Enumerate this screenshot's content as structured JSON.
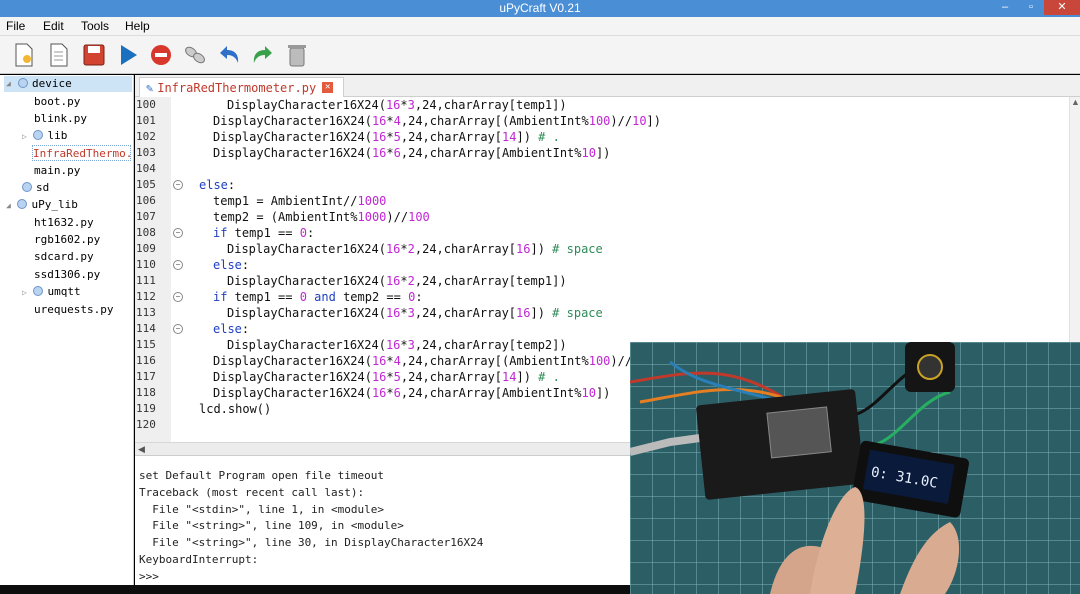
{
  "window": {
    "title": "uPyCraft V0.21"
  },
  "menu": [
    "File",
    "Edit",
    "Tools",
    "Help"
  ],
  "toolbar": [
    {
      "name": "new-file-icon"
    },
    {
      "name": "open-file-icon"
    },
    {
      "name": "save-icon"
    },
    {
      "name": "run-icon"
    },
    {
      "name": "stop-icon"
    },
    {
      "name": "connect-icon"
    },
    {
      "name": "undo-icon"
    },
    {
      "name": "redo-icon"
    },
    {
      "name": "delete-icon"
    }
  ],
  "sidebar": {
    "items": [
      {
        "label": "device",
        "expanded": true
      },
      {
        "label": "boot.py"
      },
      {
        "label": "blink.py"
      },
      {
        "label": "lib"
      },
      {
        "label": "InfraRedThermo..."
      },
      {
        "label": "main.py"
      },
      {
        "label": "sd"
      },
      {
        "label": "uPy_lib",
        "expanded": true
      },
      {
        "label": "ht1632.py"
      },
      {
        "label": "rgb1602.py"
      },
      {
        "label": "sdcard.py"
      },
      {
        "label": "ssd1306.py"
      },
      {
        "label": "umqtt"
      },
      {
        "label": "urequests.py"
      }
    ]
  },
  "tab": {
    "label": "InfraRedThermometer.py"
  },
  "editor": {
    "line_numbers": [
      "100",
      "101",
      "102",
      "103",
      "104",
      "105",
      "106",
      "107",
      "108",
      "109",
      "110",
      "111",
      "112",
      "113",
      "114",
      "115",
      "116",
      "117",
      "118",
      "119",
      "120"
    ]
  },
  "console": {
    "lines": [
      "set Default Program open file timeout",
      "Traceback (most recent call last):",
      "  File \"<stdin>\", line 1, in <module>",
      "  File \"<string>\", line 109, in <module>",
      "  File \"<string>\", line 30, in DisplayCharacter16X24",
      "KeyboardInterrupt:",
      ">>> "
    ]
  },
  "video": {
    "oled_text": "0: 31.0C"
  },
  "colors": {
    "titlebar": "#4a8fd6",
    "keyword": "#1f3fbf",
    "number": "#c026d3",
    "comment": "#2e8b57",
    "open_file": "#c0392b"
  }
}
